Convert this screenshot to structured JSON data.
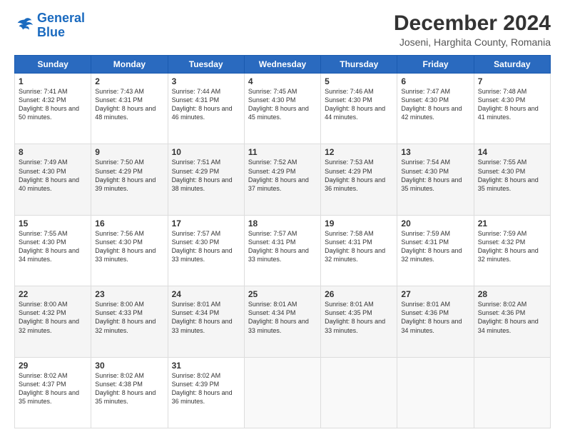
{
  "logo": {
    "line1": "General",
    "line2": "Blue"
  },
  "header": {
    "title": "December 2024",
    "subtitle": "Joseni, Harghita County, Romania"
  },
  "weekdays": [
    "Sunday",
    "Monday",
    "Tuesday",
    "Wednesday",
    "Thursday",
    "Friday",
    "Saturday"
  ],
  "weeks": [
    [
      {
        "day": "1",
        "sunrise": "7:41 AM",
        "sunset": "4:32 PM",
        "daylight": "8 hours and 50 minutes."
      },
      {
        "day": "2",
        "sunrise": "7:43 AM",
        "sunset": "4:31 PM",
        "daylight": "8 hours and 48 minutes."
      },
      {
        "day": "3",
        "sunrise": "7:44 AM",
        "sunset": "4:31 PM",
        "daylight": "8 hours and 46 minutes."
      },
      {
        "day": "4",
        "sunrise": "7:45 AM",
        "sunset": "4:30 PM",
        "daylight": "8 hours and 45 minutes."
      },
      {
        "day": "5",
        "sunrise": "7:46 AM",
        "sunset": "4:30 PM",
        "daylight": "8 hours and 44 minutes."
      },
      {
        "day": "6",
        "sunrise": "7:47 AM",
        "sunset": "4:30 PM",
        "daylight": "8 hours and 42 minutes."
      },
      {
        "day": "7",
        "sunrise": "7:48 AM",
        "sunset": "4:30 PM",
        "daylight": "8 hours and 41 minutes."
      }
    ],
    [
      {
        "day": "8",
        "sunrise": "7:49 AM",
        "sunset": "4:30 PM",
        "daylight": "8 hours and 40 minutes."
      },
      {
        "day": "9",
        "sunrise": "7:50 AM",
        "sunset": "4:29 PM",
        "daylight": "8 hours and 39 minutes."
      },
      {
        "day": "10",
        "sunrise": "7:51 AM",
        "sunset": "4:29 PM",
        "daylight": "8 hours and 38 minutes."
      },
      {
        "day": "11",
        "sunrise": "7:52 AM",
        "sunset": "4:29 PM",
        "daylight": "8 hours and 37 minutes."
      },
      {
        "day": "12",
        "sunrise": "7:53 AM",
        "sunset": "4:29 PM",
        "daylight": "8 hours and 36 minutes."
      },
      {
        "day": "13",
        "sunrise": "7:54 AM",
        "sunset": "4:30 PM",
        "daylight": "8 hours and 35 minutes."
      },
      {
        "day": "14",
        "sunrise": "7:55 AM",
        "sunset": "4:30 PM",
        "daylight": "8 hours and 35 minutes."
      }
    ],
    [
      {
        "day": "15",
        "sunrise": "7:55 AM",
        "sunset": "4:30 PM",
        "daylight": "8 hours and 34 minutes."
      },
      {
        "day": "16",
        "sunrise": "7:56 AM",
        "sunset": "4:30 PM",
        "daylight": "8 hours and 33 minutes."
      },
      {
        "day": "17",
        "sunrise": "7:57 AM",
        "sunset": "4:30 PM",
        "daylight": "8 hours and 33 minutes."
      },
      {
        "day": "18",
        "sunrise": "7:57 AM",
        "sunset": "4:31 PM",
        "daylight": "8 hours and 33 minutes."
      },
      {
        "day": "19",
        "sunrise": "7:58 AM",
        "sunset": "4:31 PM",
        "daylight": "8 hours and 32 minutes."
      },
      {
        "day": "20",
        "sunrise": "7:59 AM",
        "sunset": "4:31 PM",
        "daylight": "8 hours and 32 minutes."
      },
      {
        "day": "21",
        "sunrise": "7:59 AM",
        "sunset": "4:32 PM",
        "daylight": "8 hours and 32 minutes."
      }
    ],
    [
      {
        "day": "22",
        "sunrise": "8:00 AM",
        "sunset": "4:32 PM",
        "daylight": "8 hours and 32 minutes."
      },
      {
        "day": "23",
        "sunrise": "8:00 AM",
        "sunset": "4:33 PM",
        "daylight": "8 hours and 32 minutes."
      },
      {
        "day": "24",
        "sunrise": "8:01 AM",
        "sunset": "4:34 PM",
        "daylight": "8 hours and 33 minutes."
      },
      {
        "day": "25",
        "sunrise": "8:01 AM",
        "sunset": "4:34 PM",
        "daylight": "8 hours and 33 minutes."
      },
      {
        "day": "26",
        "sunrise": "8:01 AM",
        "sunset": "4:35 PM",
        "daylight": "8 hours and 33 minutes."
      },
      {
        "day": "27",
        "sunrise": "8:01 AM",
        "sunset": "4:36 PM",
        "daylight": "8 hours and 34 minutes."
      },
      {
        "day": "28",
        "sunrise": "8:02 AM",
        "sunset": "4:36 PM",
        "daylight": "8 hours and 34 minutes."
      }
    ],
    [
      {
        "day": "29",
        "sunrise": "8:02 AM",
        "sunset": "4:37 PM",
        "daylight": "8 hours and 35 minutes."
      },
      {
        "day": "30",
        "sunrise": "8:02 AM",
        "sunset": "4:38 PM",
        "daylight": "8 hours and 35 minutes."
      },
      {
        "day": "31",
        "sunrise": "8:02 AM",
        "sunset": "4:39 PM",
        "daylight": "8 hours and 36 minutes."
      },
      null,
      null,
      null,
      null
    ]
  ]
}
